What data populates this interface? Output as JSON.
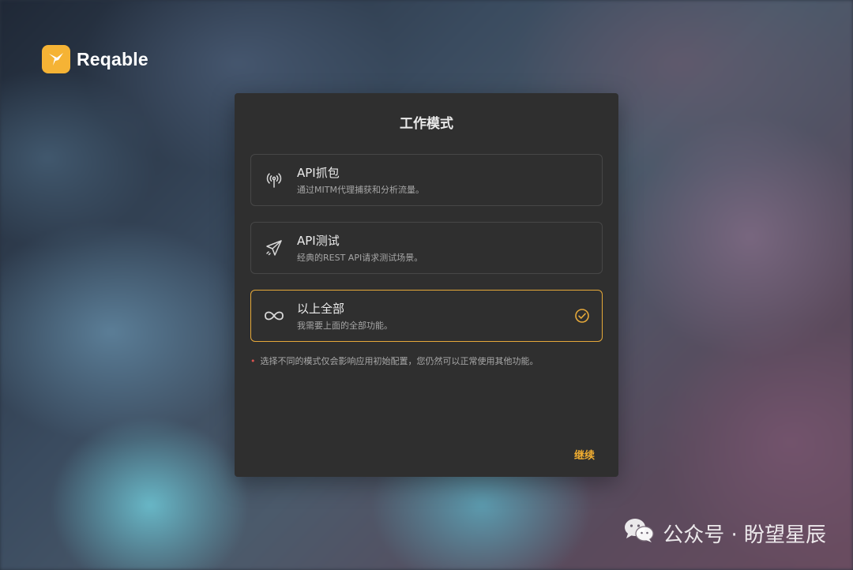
{
  "brand": {
    "name": "Reqable",
    "accent": "#f5b335"
  },
  "dialog": {
    "title": "工作模式",
    "options": [
      {
        "icon": "antenna-icon",
        "title": "API抓包",
        "description": "通过MITM代理捕获和分析流量。",
        "selected": false
      },
      {
        "icon": "paper-plane-icon",
        "title": "API测试",
        "description": "经典的REST API请求测试场景。",
        "selected": false
      },
      {
        "icon": "infinity-icon",
        "title": "以上全部",
        "description": "我需要上面的全部功能。",
        "selected": true
      }
    ],
    "note": "选择不同的模式仅会影响应用初始配置，您仍然可以正常使用其他功能。",
    "continue_label": "继续",
    "selected_color": "#e6a93a"
  },
  "watermark": {
    "text": "公众号 · 盼望星辰",
    "icon": "wechat-icon"
  }
}
